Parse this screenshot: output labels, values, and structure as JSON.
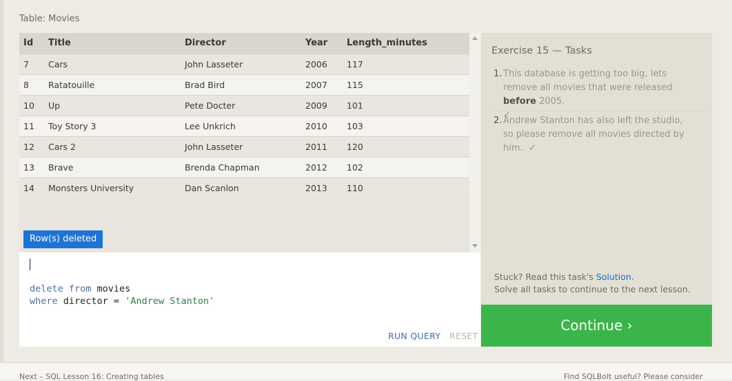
{
  "table": {
    "caption": "Table: Movies",
    "columns": [
      "Id",
      "Title",
      "Director",
      "Year",
      "Length_minutes"
    ],
    "rows": [
      [
        "7",
        "Cars",
        "John Lasseter",
        "2006",
        "117"
      ],
      [
        "8",
        "Ratatouille",
        "Brad Bird",
        "2007",
        "115"
      ],
      [
        "10",
        "Up",
        "Pete Docter",
        "2009",
        "101"
      ],
      [
        "11",
        "Toy Story 3",
        "Lee Unkrich",
        "2010",
        "103"
      ],
      [
        "12",
        "Cars 2",
        "John Lasseter",
        "2011",
        "120"
      ],
      [
        "13",
        "Brave",
        "Brenda Chapman",
        "2012",
        "102"
      ],
      [
        "14",
        "Monsters University",
        "Dan Scanlon",
        "2013",
        "110"
      ]
    ]
  },
  "status": {
    "message": "Row(s) deleted",
    "color": "#1e73d6"
  },
  "editor": {
    "line1_kw": "delete from",
    "line1_rest": " movies",
    "line2_kw": "where",
    "line2_mid": " director = ",
    "line2_str": "'Andrew Stanton'",
    "run_label": "RUN QUERY",
    "reset_label": "RESET"
  },
  "tasks": {
    "title": "Exercise 15 — Tasks",
    "items": [
      {
        "num": "1.",
        "text_before": "This database is getting too big, lets remove all movies that were released ",
        "bold": "before",
        "text_after": " 2005.",
        "check": "✓"
      },
      {
        "num": "2.",
        "text_before": "Andrew Stanton has also left the studio, so please remove all movies directed by him.",
        "check": "✓"
      }
    ],
    "stuck_prefix": "Stuck? Read this task's ",
    "solution_link": "Solution",
    "stuck_suffix": ".",
    "solve_all": "Solve all tasks to continue to the next lesson."
  },
  "continue_button": {
    "label": "Continue ›",
    "color": "#3bb54a"
  },
  "footer": {
    "left": "Next – SQL Lesson 16: Creating tables",
    "right": "Find SQLBolt useful? Please consider"
  }
}
